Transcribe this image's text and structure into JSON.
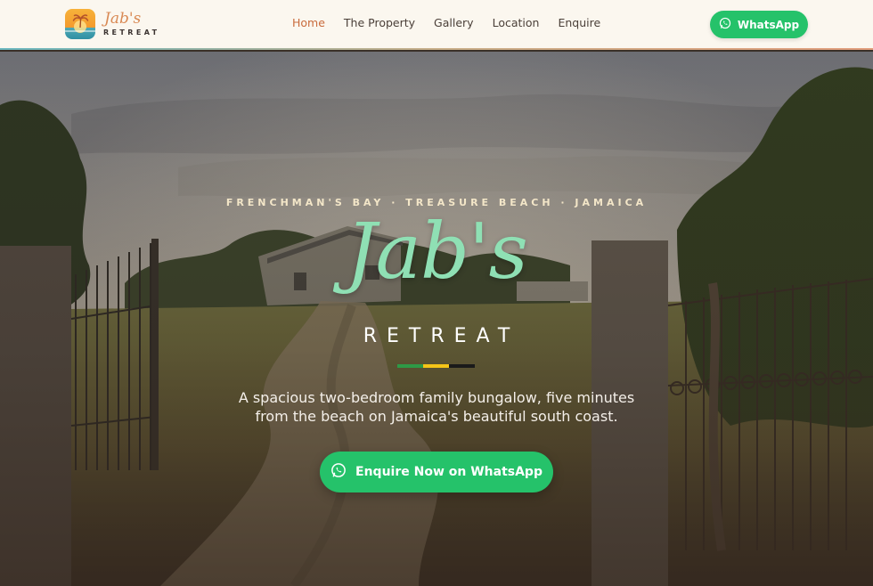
{
  "header": {
    "logo": {
      "script": "Jab's",
      "sub": "RETREAT"
    },
    "nav": [
      {
        "label": "Home",
        "active": true
      },
      {
        "label": "The Property",
        "active": false
      },
      {
        "label": "Gallery",
        "active": false
      },
      {
        "label": "Location",
        "active": false
      },
      {
        "label": "Enquire",
        "active": false
      }
    ],
    "whatsapp_label": "WhatsApp"
  },
  "hero": {
    "kicker": "FRENCHMAN'S BAY · TREASURE BEACH · JAMAICA",
    "title_script": "Jab's",
    "title_sub": "RETREAT",
    "tagline_line1": "A spacious two-bedroom family bungalow, five minutes",
    "tagline_line2": "from the beach on Jamaica's beautiful south coast.",
    "cta_label": "Enquire Now on WhatsApp"
  },
  "icons": {
    "logo": "palm-sunset-icon",
    "whatsapp": "whatsapp-icon"
  },
  "colors": {
    "accent": "#c96b3c",
    "whatsapp_green": "#25c26a",
    "script_green": "#8fe0b4",
    "flag": [
      "#2e9a46",
      "#f5c518",
      "#1a1a1a"
    ]
  }
}
